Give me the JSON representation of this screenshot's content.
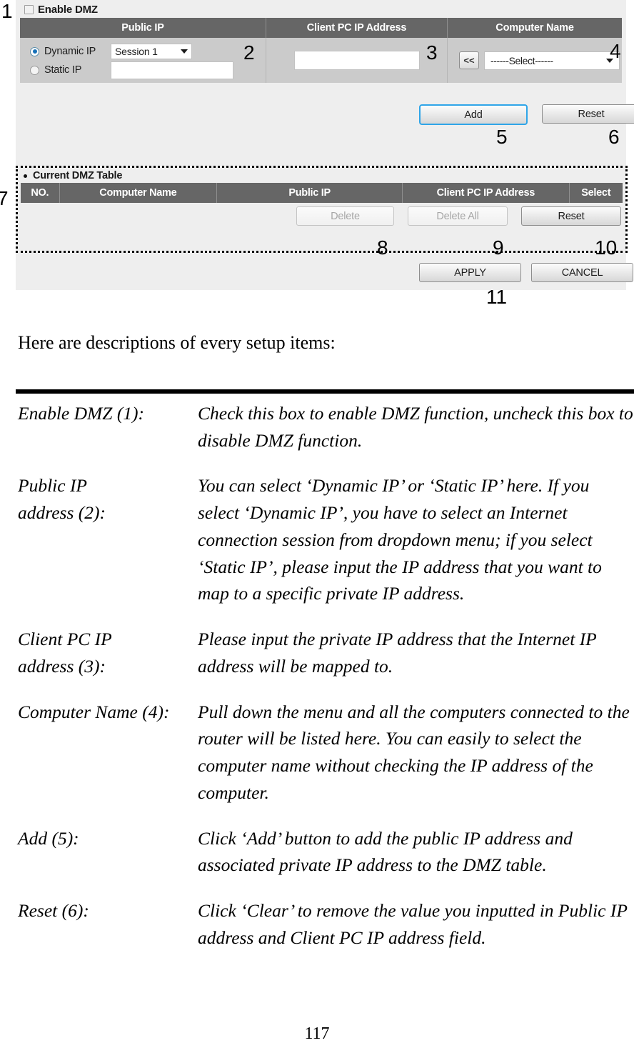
{
  "screenshot": {
    "enable_dmz": {
      "label": "Enable DMZ",
      "checked": false
    },
    "config_table": {
      "headers": [
        "Public IP",
        "Client PC IP Address",
        "Computer Name"
      ],
      "public_ip": {
        "dynamic_label": "Dynamic IP",
        "dynamic_selected": true,
        "session_select_value": "Session 1",
        "static_label": "Static IP",
        "static_selected": false,
        "static_value": ""
      },
      "client_pc_ip_value": "",
      "computer_name": {
        "insert_button_label": "<<",
        "select_value": "------Select------"
      }
    },
    "form_buttons": {
      "add_label": "Add",
      "reset_label": "Reset"
    },
    "dmz_table": {
      "title": "Current DMZ Table",
      "headers": [
        "NO.",
        "Computer Name",
        "Public IP",
        "Client PC IP Address",
        "Select"
      ],
      "rows": [],
      "buttons": {
        "delete_label": "Delete",
        "delete_disabled": true,
        "delete_all_label": "Delete All",
        "delete_all_disabled": true,
        "reset_label": "Reset",
        "reset_disabled": false
      }
    },
    "page_buttons": {
      "apply_label": "APPLY",
      "cancel_label": "CANCEL"
    },
    "callouts": {
      "n1": "1",
      "n2": "2",
      "n3": "3",
      "n4": "4",
      "n5": "5",
      "n6": "6",
      "n7": "7",
      "n8": "8",
      "n9": "9",
      "n10": "10",
      "n11": "11"
    },
    "colors": {
      "header_bg": "#666666",
      "panel_bg": "#eeeeee",
      "row_bg": "#cbcbcb",
      "focus_ring": "#2fa5e8",
      "radio_dot": "#1570b8"
    }
  },
  "document": {
    "intro": "Here are descriptions of every setup items:",
    "items": [
      {
        "term_line1": "Enable DMZ (1):",
        "term_line2": "",
        "description": "Check this box to enable DMZ function, uncheck this box to disable DMZ function."
      },
      {
        "term_line1": "Public IP",
        "term_line2": "address (2):",
        "description": "You can select ‘Dynamic IP’ or ‘Static IP’ here. If you select ‘Dynamic IP’, you have to select an Internet connection session from dropdown menu; if you select ‘Static IP’, please input the IP address that you want to map to a specific private IP address."
      },
      {
        "term_line1": "Client PC IP",
        "term_line2": "address (3):",
        "description": "Please input the private IP address that the Internet IP address will be mapped to."
      },
      {
        "term_line1": "Computer Name (4):",
        "term_line2": "",
        "description": "Pull down the menu and all the computers connected to the router will be listed here. You can easily to select the computer name without checking the IP address of the computer."
      },
      {
        "term_line1": "Add (5):",
        "term_line2": "",
        "description": "Click ‘Add’ button to add the public IP address and associated private IP address to the DMZ table."
      },
      {
        "term_line1": "Reset (6):",
        "term_line2": "",
        "description": "Click ‘Clear’ to remove the value you inputted in Public IP address and Client PC IP address field."
      }
    ],
    "page_number": "117"
  }
}
